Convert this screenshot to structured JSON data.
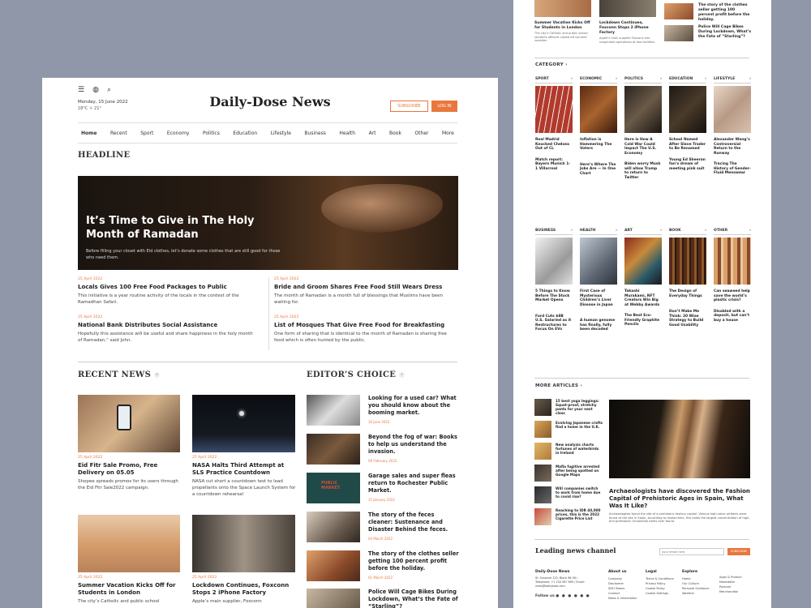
{
  "header": {
    "date": "Monday, 15 June 2022",
    "weather": "18°C  ☼  21°",
    "logo": "Daily-Dose News",
    "subscribe": "SUBSCRIBE",
    "login": "LOG IN"
  },
  "nav": [
    "Home",
    "Recent",
    "Sport",
    "Economy",
    "Politics",
    "Education",
    "Lifestyle",
    "Business",
    "Health",
    "Art",
    "Book",
    "Other",
    "More"
  ],
  "headline": {
    "section": "HEADLINE",
    "title": "It’s Time to Give in The Holy Month of Ramadan",
    "desc": "Before filling your closet with Eid clothes, let’s donate some clothes that are still good for those who need them."
  },
  "sub_articles": [
    {
      "date": "25 April 2022",
      "title": "Locals Gives 100 Free Food Packages to Public",
      "snippet": "This initiative is a year routine activity of the locals in the context of the Ramadhan Safari."
    },
    {
      "date": "25 April 2022",
      "title": "Bride and Groom Shares Free Food Still Wears Dress",
      "snippet": "The month of Ramadan is a month full of blessings that Muslims have been waiting for."
    },
    {
      "date": "25 April 2022",
      "title": "National Bank Distributes Social Assistance",
      "snippet": "Hopefully this assistance will be useful and share happiness in the holy month of Ramadan,” said John."
    },
    {
      "date": "25 April 2022",
      "title": "List of Mosques That Give Free Food for Breakfasting",
      "snippet": "One form of sharing that is identical to the month of Ramadan is sharing free food which is often hunted by the public."
    }
  ],
  "recent": {
    "section": "RECENT NEWS",
    "items": [
      {
        "date": "25 April 2022",
        "title": "Eid Fitr Sale Promo, Free Delivery on 05.05",
        "snippet": "Shopee spreads promos for its users through the Eid Fitr Sale2022 campaign."
      },
      {
        "date": "25 April 2022",
        "title": "NASA Halts Third Attempt at SLS Practice Countdown",
        "snippet": "NASA cut short a countdown test to load propellants onto the Space Launch System for a countdown rehearsal"
      },
      {
        "date": "25 April 2022",
        "title": "Summer Vacation Kicks Off for Students in London",
        "snippet": "The city’s Catholic and public school"
      },
      {
        "date": "25 April 2022",
        "title": "Lockdown Continues, Foxconn Stops 2 iPhone Factory",
        "snippet": "Apple’s main supplier, Foxconn"
      }
    ]
  },
  "editors": {
    "section": "EDITOR’S CHOICE",
    "items": [
      {
        "title": "Looking for a used car? What you should know about the booming market.",
        "date": "16 June 2022"
      },
      {
        "title": "Beyond the fog of war: Books to help us understand the invasion.",
        "date": "09 February 2022"
      },
      {
        "title": "Garage sales and super fleas return to Rochester Public Market.",
        "date": "15 January 2022"
      },
      {
        "title": "The story of the feces cleaner: Sustenance and Disaster Behind the feces.",
        "date": "04 March 2022"
      },
      {
        "title": "The story of the clothes seller getting 100 percent profit before the holiday.",
        "date": "01 March 2022"
      },
      {
        "title": "Police Will Cage Bikes During Lockdown, What’s the Fate of “Starling”?",
        "date": ""
      }
    ]
  },
  "right": {
    "top_items": [
      {
        "title": "Summer Vacation Kicks Off for Students in London",
        "snippet": "The city’s Catholic and public school students officials closed off summer vacation"
      },
      {
        "title": "Lockdown Continues, Foxconn Stops 2 iPhone Factory",
        "snippet": "Apple’s main supplier Foxconn has suspended operations at two facilities"
      },
      {
        "title": "The story of the clothes seller getting 100 percent profit before the holiday."
      },
      {
        "title": "Police Will Cage Bikes During Lockdown, What’s the Fate of “Starling”?"
      }
    ],
    "category_label": "CATEGORY",
    "cats1": [
      {
        "name": "SPORT",
        "t1": "Real Madrid Knocked Chelsea Out of CL",
        "t2": "Match report: Bayern Munich 1-1 Villarreal"
      },
      {
        "name": "ECONOMIC",
        "t1": "Inflation is Hammering The Voters",
        "t2": "Here’s Where The Jobs Are — In One Chart"
      },
      {
        "name": "POLITICS",
        "t1": "Here is How A Cold War Could Impact The U.S. Economy",
        "t2": "Biden worry Musk will allow Trump to return to Twitter"
      },
      {
        "name": "EDUCATION",
        "t1": "School Named After Slave Trader to Be Renamed",
        "t2": "Young Ed Sheeran fan’s dream of meeting pink suit"
      },
      {
        "name": "LIFESTYLE",
        "t1": "Alexander Wang’s Controversial Return to the Runway",
        "t2": "Tracing The History of Gender-Fluid Menswear"
      }
    ],
    "cats2": [
      {
        "name": "BUSINESS",
        "t1": "5 Things to Know Before The Stock Market Opens",
        "t2": "Ford Cuts $8B U.S. Salaried as it Restructures to Focus On EVs"
      },
      {
        "name": "HEALTH",
        "t1": "First Case of Mysterious Children’s Liver Disease in Japan",
        "t2": "A human genome has finally, fully been decoded"
      },
      {
        "name": "ART",
        "t1": "Takashi Murakami, NFT Creators Win Big at Webby Awards",
        "t2": "The Best Eco-Friendly Graphite Pencils"
      },
      {
        "name": "BOOK",
        "t1": "The Design of Everyday Things",
        "t2": "Don’t Make Me Think: 20 Wise Strategy to Build Good Usability"
      },
      {
        "name": "OTHER",
        "t1": "Can seaweed help save the world’s plastic crisis?",
        "t2": "Disabled with a deposit, but can’t buy a house"
      }
    ],
    "more_label": "MORE ARTICLES",
    "more_items": [
      {
        "title": "15 best yoga leggings: Squat-proof, stretchy pants for your next class",
        "date": "25 April 2022"
      },
      {
        "title": "Evolving Japanese crafts find a home in the U.K.",
        "date": "25 April 2022"
      },
      {
        "title": "New analysis charts fortunes of waterbirds in Ireland",
        "date": "25 April 2022"
      },
      {
        "title": "Mafia fugitive arrested after being spotted on Google Maps",
        "date": "25 April 2022"
      },
      {
        "title": "Will companies switch to work from home due to covid rise?",
        "date": "25 April 2022"
      },
      {
        "title": "Reaching to IDR 40,000 prices, this is the 2022 Cigarette Price List",
        "date": "25 April 2022"
      }
    ],
    "feature": {
      "title": "Archaeologists have discovered the Fashion Capital of Prehistoric Ages in Spain, What Was It Like?",
      "snippet": "Archaeologists found the site of a prehistoric fashion capital. Various high-value artifacts were found at the site in Spain. According to researchers, this holds the largest concentration of high-end prehistoric Ornaments items ever found."
    },
    "newsletter": {
      "title": "Leading news channel",
      "placeholder": "your email here",
      "button": "SUBSCRIBE"
    },
    "footer": {
      "brand": "Daily-Dose News",
      "address": "St. Susanne 123, Block 98-56 / Telephone: +1 234 567 890 / Email: news@dailydose.com",
      "follow": "Follow us",
      "about": {
        "h": "About us",
        "items": [
          "Company",
          "Disclaimer",
          "SDH Teams",
          "Contact",
          "News & information"
        ]
      },
      "legal": {
        "h": "Legal",
        "items": [
          "Terms & Conditions",
          "Privacy Policy",
          "Cookie Policy",
          "Cookie Settings"
        ]
      },
      "explore": {
        "h": "Explore",
        "items": [
          "Home",
          "Our Culture",
          "Personal Guidance",
          "Weather"
        ]
      },
      "more": {
        "h": "",
        "items": [
          "Apps & Product",
          "Newsletter",
          "Podcast",
          "Merchandise"
        ]
      }
    }
  }
}
